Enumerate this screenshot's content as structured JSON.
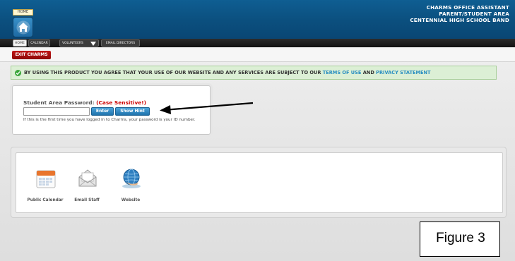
{
  "header": {
    "home_label": "HOME",
    "line1": "CHARMS OFFICE ASSISTANT",
    "line2": "PARENT/STUDENT AREA",
    "line3": "CENTENNIAL HIGH SCHOOL BAND",
    "color": "#0b4f7e"
  },
  "nav": {
    "tabs": [
      {
        "label": "HOME",
        "active": true
      },
      {
        "label": "CALENDAR",
        "active": false
      },
      {
        "label": "VOLUNTEERS",
        "active": false
      },
      {
        "label": "EMAIL DIRECTORS",
        "active": false
      }
    ]
  },
  "exit_button": {
    "label": "EXIT CHARMS",
    "color": "#b01010"
  },
  "notice": {
    "text": "BY USING THIS PRODUCT YOU AGREE THAT YOUR USE OF OUR WEBSITE AND ANY SERVICES ARE SUBJECT TO OUR",
    "terms_link": "TERMS OF USE",
    "and": "AND",
    "privacy_link": "PRIVACY STATEMENT",
    "link_color": "#2a8fc1",
    "icon": "check-circle-icon"
  },
  "password": {
    "label": "Student Area Password:",
    "case_note": "(Case Sensitive!)",
    "value": "",
    "enter_label": "Enter",
    "hint_label": "Show Hint",
    "help_text": "If this is the first time you have logged in to Charms, your password is your ID number."
  },
  "shortcuts": [
    {
      "label": "Public Calendar",
      "icon": "calendar-icon"
    },
    {
      "label": "Email Staff",
      "icon": "envelope-icon"
    },
    {
      "label": "Website",
      "icon": "globe-icon"
    }
  ],
  "figure_label": "Figure 3"
}
